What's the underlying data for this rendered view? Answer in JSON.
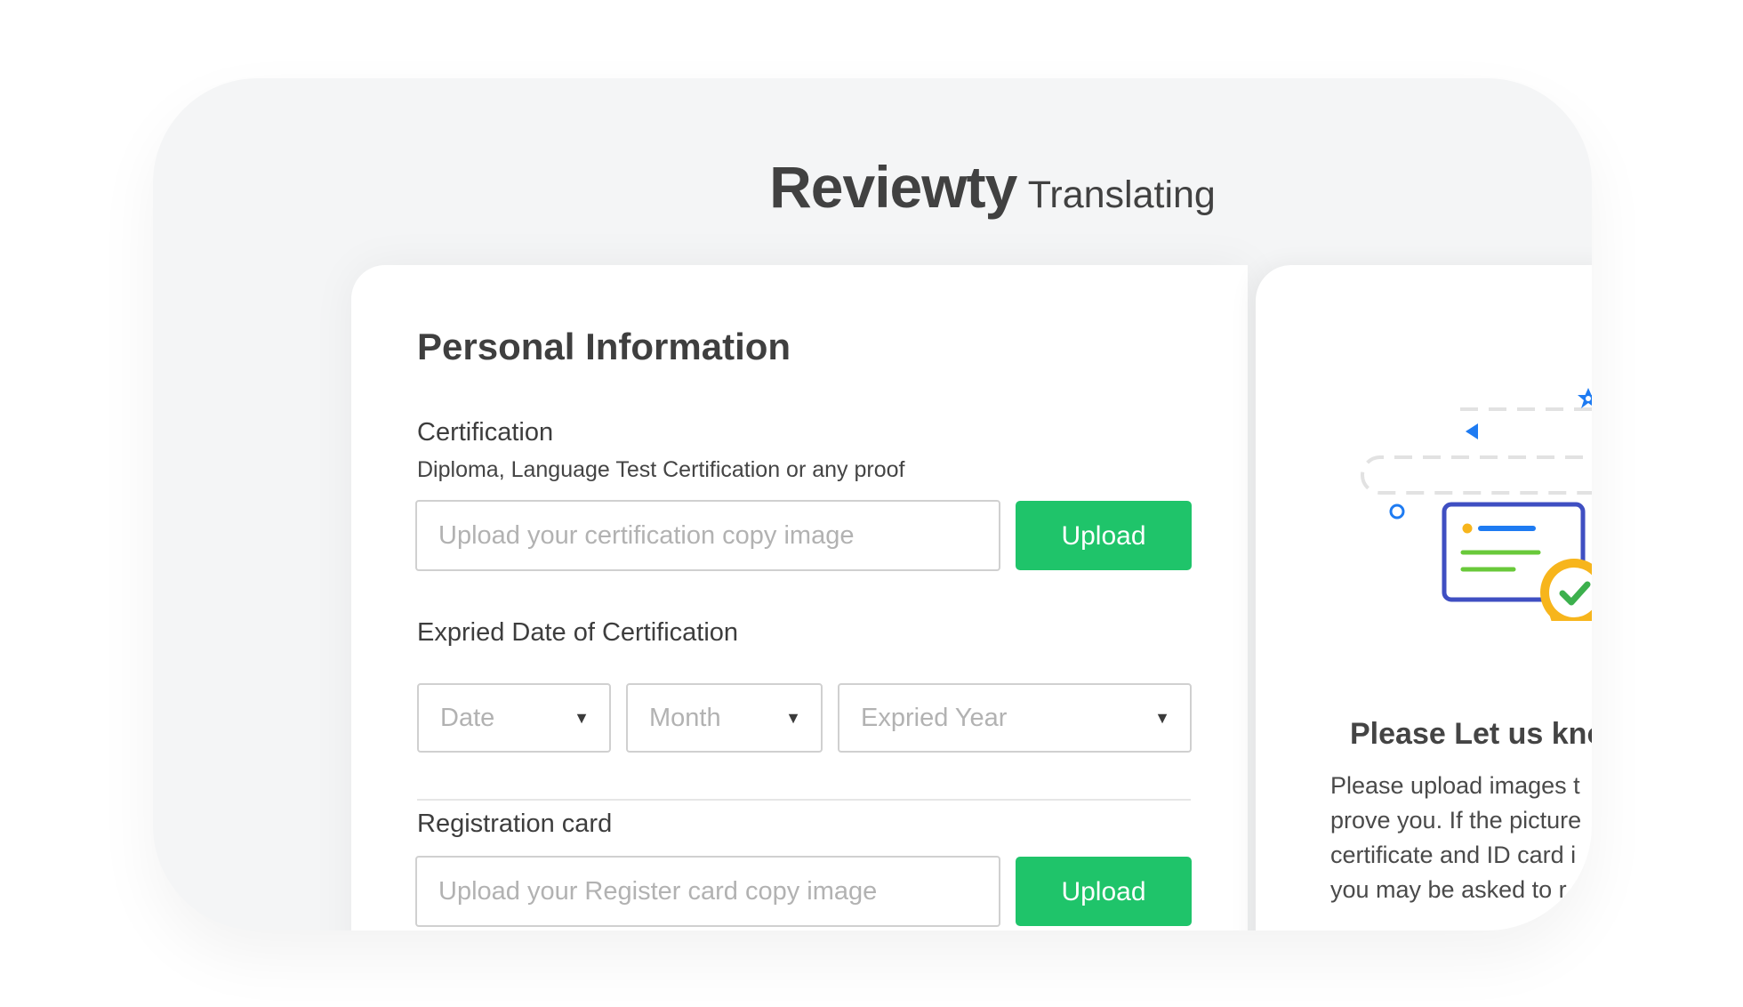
{
  "brand": {
    "name": "Reviewty",
    "subtitle": "Translating"
  },
  "form": {
    "title": "Personal Information",
    "certification": {
      "label": "Certification",
      "hint": "Diploma, Language Test Certification or any proof",
      "placeholder": "Upload your certification copy image",
      "button_label": "Upload"
    },
    "expiry": {
      "label": "Expried Date of Certification",
      "date_placeholder": "Date",
      "month_placeholder": "Month",
      "year_placeholder": "Expried Year"
    },
    "registration": {
      "label": "Registration card",
      "placeholder": "Upload your Register card copy image",
      "button_label": "Upload"
    }
  },
  "side_panel": {
    "title": "Please Let us kno",
    "lines": [
      "Please upload images t",
      "prove you. If the picture",
      "certificate and ID card i",
      "you may be asked to r"
    ]
  },
  "colors": {
    "accent_green": "#1fc46a",
    "illus_blue": "#1e7bf2",
    "illus_navy": "#3f4fc2",
    "illus_gold": "#f7b51c"
  },
  "icons": {
    "caret": "caret-down-icon",
    "illustration": "certificate-illustration"
  }
}
